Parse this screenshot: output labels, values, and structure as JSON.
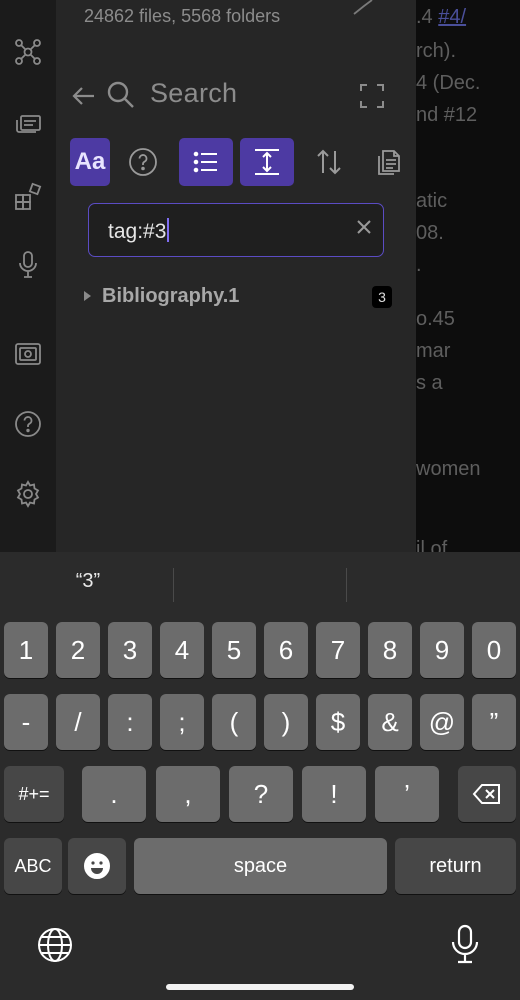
{
  "background_note": {
    "lines": [
      {
        "text": ".4 ",
        "link": "#4/"
      },
      {
        "text": "rch)."
      },
      {
        "text": "4 (Dec."
      },
      {
        "text": "nd #12"
      },
      {
        "text": "atic"
      },
      {
        "text": "08."
      },
      {
        "text": "."
      },
      {
        "text": "o.45"
      },
      {
        "text": "mar"
      },
      {
        "text": "s a"
      },
      {
        "text": "women"
      },
      {
        "text": "il of"
      }
    ]
  },
  "ribbon": {
    "icons": [
      "graph-view-icon",
      "slides-icon",
      "blocks-icon",
      "microphone-icon",
      "vault-icon",
      "help-icon",
      "settings-icon"
    ]
  },
  "panel": {
    "file_count": "24862 files, 5568 folders",
    "title": "Search",
    "toolbar": {
      "match_case_label": "Aa"
    },
    "search": {
      "value": "tag:#3",
      "placeholder": ""
    },
    "results": [
      {
        "name": "Bibliography.1",
        "count": "3"
      }
    ]
  },
  "colors": {
    "accent": "#4d3aa3",
    "accent_border": "#5b4cc4",
    "panel_bg": "#262626",
    "keyboard_bg": "#2b2b2b"
  },
  "keyboard": {
    "suggestions": [
      "“3”",
      "",
      ""
    ],
    "row1": [
      "1",
      "2",
      "3",
      "4",
      "5",
      "6",
      "7",
      "8",
      "9",
      "0"
    ],
    "row2": [
      "-",
      "/",
      ":",
      ";",
      "(",
      ")",
      "$",
      "&",
      "@",
      "”"
    ],
    "row3": {
      "shift": "#+=",
      "keys": [
        ".",
        ",",
        "?",
        "!",
        "’"
      ]
    },
    "row4": {
      "abc": "ABC",
      "space": "space",
      "return": "return"
    }
  }
}
